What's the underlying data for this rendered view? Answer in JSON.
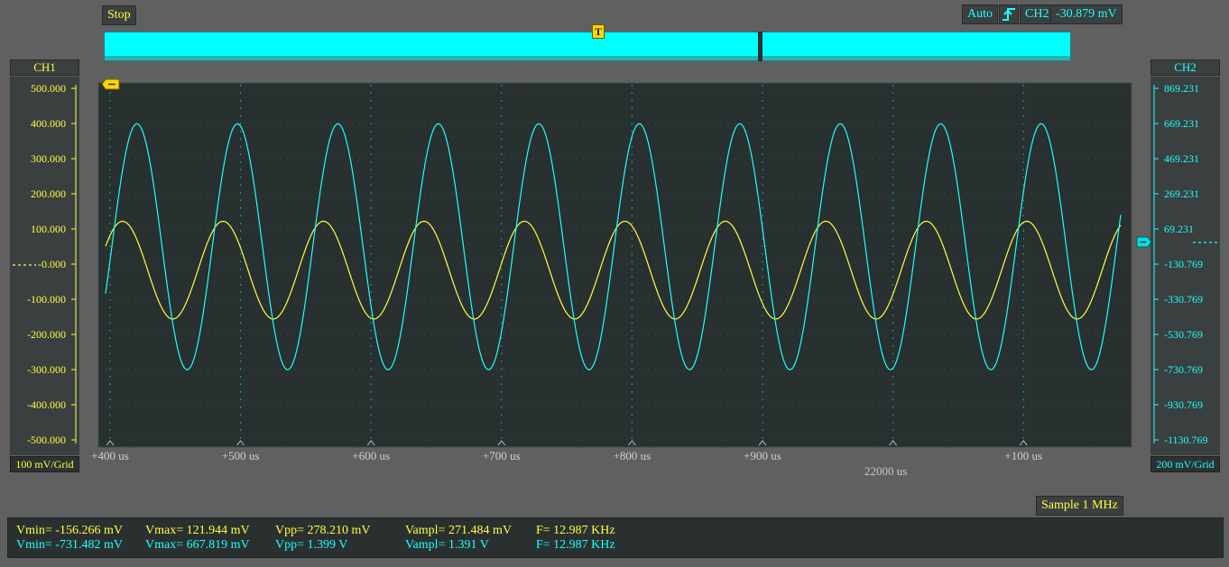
{
  "toolbar": {
    "run_state": "Stop",
    "trigger_mode": "Auto",
    "trigger_edge_icon": "rising-edge-icon",
    "trigger_source": "CH2",
    "trigger_level": "-30.879 mV"
  },
  "overview": {
    "trigger_marker": "T"
  },
  "channels": {
    "ch1": {
      "name": "CH1",
      "color": "#ffff40",
      "scale": "100 mV/Grid",
      "ticks": [
        "500.000",
        "400.000",
        "300.000",
        "200.000",
        "100.000",
        "-0.000",
        "-100.000",
        "-200.000",
        "-300.000",
        "-400.000",
        "-500.000"
      ]
    },
    "ch2": {
      "name": "CH2",
      "color": "#20ffff",
      "scale": "200 mV/Grid",
      "ticks": [
        "869.231",
        "669.231",
        "469.231",
        "269.231",
        "69.231",
        "-130.769",
        "-330.769",
        "-530.769",
        "-730.769",
        "-930.769",
        "-1130.769"
      ]
    }
  },
  "time_axis": {
    "ticks": [
      "+400 us",
      "+500 us",
      "+600 us",
      "+700 us",
      "+800 us",
      "+900 us",
      "",
      "+100 us"
    ],
    "reference": "22000 us"
  },
  "sample_rate": "Sample 1 MHz",
  "measurements": {
    "ch1": {
      "vmin": "Vmin= -156.266 mV",
      "vmax": "Vmax= 121.944 mV",
      "vpp": "Vpp= 278.210 mV",
      "vampl": "Vampl= 271.484 mV",
      "freq": "F= 12.987 KHz"
    },
    "ch2": {
      "vmin": "Vmin= -731.482 mV",
      "vmax": "Vmax= 667.819 mV",
      "vpp": "Vpp= 1.399 V",
      "vampl": "Vampl= 1.391 V",
      "freq": "F= 12.987 KHz"
    }
  },
  "chart_data": {
    "type": "line",
    "x_unit": "us",
    "series": [
      {
        "name": "CH1",
        "color": "#ffff40",
        "frequency_khz": 12.987,
        "vmin_mv": -156.266,
        "vmax_mv": 121.944
      },
      {
        "name": "CH2",
        "color": "#20ffff",
        "frequency_khz": 12.987,
        "vmin_mv": -731.482,
        "vmax_mv": 667.819
      }
    ]
  }
}
